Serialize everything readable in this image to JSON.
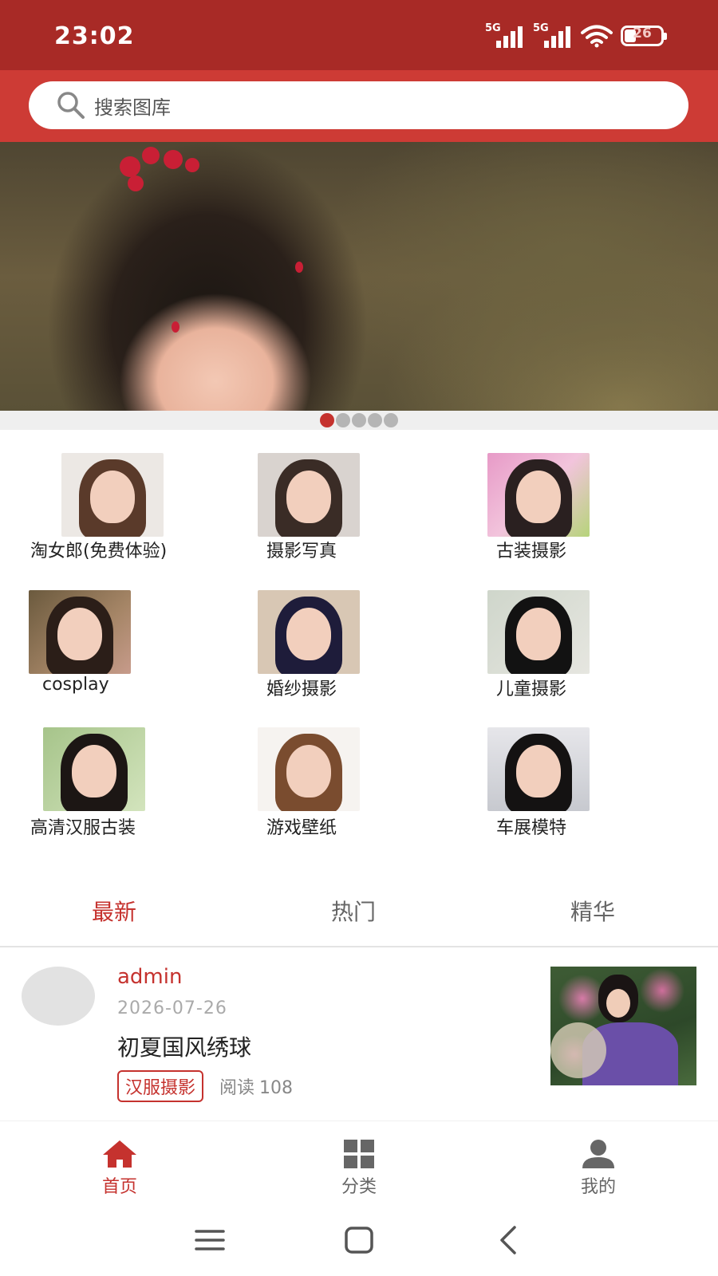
{
  "status_bar": {
    "time": "23:02",
    "signal1_label": "5G",
    "signal2_label": "5G",
    "battery_level": "26",
    "icons": [
      "signal-5g-icon",
      "signal-5g-icon",
      "wifi-icon",
      "battery-icon"
    ]
  },
  "search": {
    "placeholder": "搜索图库",
    "icon": "search-icon"
  },
  "banner": {
    "slide_count": 5,
    "active_slide": 1
  },
  "categories": [
    {
      "label": "淘女郎(免费体验)"
    },
    {
      "label": "摄影写真"
    },
    {
      "label": "古装摄影"
    },
    {
      "label": "cosplay"
    },
    {
      "label": "婚纱摄影"
    },
    {
      "label": "儿童摄影"
    },
    {
      "label": "高清汉服古装"
    },
    {
      "label": "游戏壁纸"
    },
    {
      "label": "车展模特"
    }
  ],
  "tabs": [
    {
      "label": "最新",
      "active": true
    },
    {
      "label": "热门",
      "active": false
    },
    {
      "label": "精华",
      "active": false
    }
  ],
  "article": {
    "author": "admin",
    "date": "2026-07-26",
    "title": "初夏国风绣球",
    "tag": "汉服摄影",
    "reads_label": "阅读",
    "reads_count": "108"
  },
  "bottom_nav": [
    {
      "label": "首页",
      "icon": "home-icon",
      "active": true
    },
    {
      "label": "分类",
      "icon": "grid-icon",
      "active": false
    },
    {
      "label": "我的",
      "icon": "user-icon",
      "active": false
    }
  ],
  "system_nav": [
    "menu-icon",
    "home-square-icon",
    "back-icon"
  ],
  "colors": {
    "status_bar": "#a82a26",
    "header": "#cd3b35",
    "accent": "#c5322e"
  }
}
